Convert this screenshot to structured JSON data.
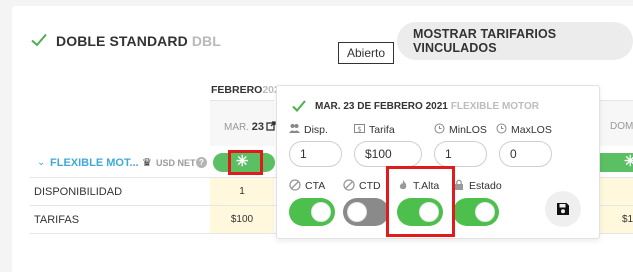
{
  "header": {
    "title": "DOBLE STANDARD",
    "code": "DBL",
    "linked_rates_button": "MOSTRAR TARIFARIOS VINCULADOS",
    "tooltip": "Abierto"
  },
  "calendar": {
    "month": "FEBRERO",
    "year": "202",
    "day_prefix": "MAR.",
    "day_number": "23",
    "day_right": "DOM"
  },
  "rate": {
    "name": "FLEXIBLE MOT...",
    "currency": "USD NET",
    "help": "?",
    "cell_symbol": "✳"
  },
  "rows": [
    {
      "label": "DISPONIBILIDAD",
      "value": "1",
      "value_right": ""
    },
    {
      "label": "TARIFAS",
      "value": "$100",
      "value_right": "$1"
    }
  ],
  "popup": {
    "date": "MAR. 23 DE FEBRERO 2021",
    "plan": "FLEXIBLE MOTOR",
    "fields": [
      {
        "label": "Disp.",
        "value": "1",
        "icon": "people-icon"
      },
      {
        "label": "Tarifa",
        "value": "$100",
        "icon": "money-icon"
      },
      {
        "label": "MinLOS",
        "value": "1",
        "icon": "clock-icon"
      },
      {
        "label": "MaxLOS",
        "value": "0",
        "icon": "clock-icon"
      }
    ],
    "toggles": [
      {
        "label": "CTA",
        "state": "on",
        "icon": "no-entry-icon"
      },
      {
        "label": "CTD",
        "state": "off",
        "icon": "no-entry-icon"
      },
      {
        "label": "T.Alta",
        "state": "on",
        "icon": "flame-icon"
      },
      {
        "label": "Estado",
        "state": "on",
        "icon": "lock-icon"
      }
    ],
    "save_icon": "save-icon"
  },
  "colors": {
    "green": "#5bbf63",
    "toggle_on": "#4dbf4d",
    "link_blue": "#3fa9d8",
    "highlight_red": "#e01b1b",
    "yellow_cell": "#fff8dc"
  }
}
